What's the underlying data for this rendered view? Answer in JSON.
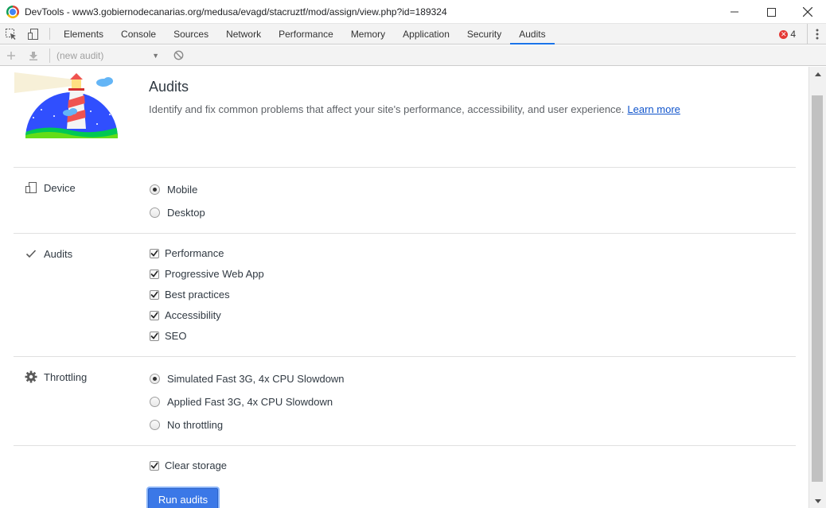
{
  "window": {
    "title": "DevTools - www3.gobiernodecanarias.org/medusa/evagd/stacruztf/mod/assign/view.php?id=189324"
  },
  "tabs": [
    "Elements",
    "Console",
    "Sources",
    "Network",
    "Performance",
    "Memory",
    "Application",
    "Security",
    "Audits"
  ],
  "active_tab": "Audits",
  "error_count": "4",
  "audit_toolbar": {
    "select_value": "(new audit)"
  },
  "header": {
    "title": "Audits",
    "description": "Identify and fix common problems that affect your site's performance, accessibility, and user experience.",
    "learn_more": "Learn more"
  },
  "device": {
    "label": "Device",
    "options": [
      "Mobile",
      "Desktop"
    ],
    "selected": "Mobile"
  },
  "audits": {
    "label": "Audits",
    "categories": [
      "Performance",
      "Progressive Web App",
      "Best practices",
      "Accessibility",
      "SEO"
    ]
  },
  "throttling": {
    "label": "Throttling",
    "options": [
      "Simulated Fast 3G, 4x CPU Slowdown",
      "Applied Fast 3G, 4x CPU Slowdown",
      "No throttling"
    ],
    "selected": "Simulated Fast 3G, 4x CPU Slowdown"
  },
  "clear_storage": {
    "label": "Clear storage",
    "checked": true
  },
  "run_button": "Run audits"
}
